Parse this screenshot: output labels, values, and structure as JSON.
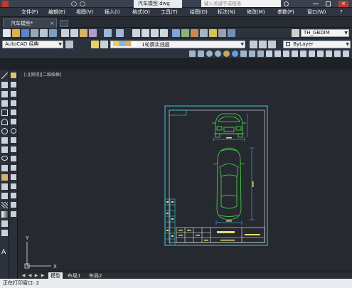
{
  "window": {
    "title_tab": "汽车模型.dwg",
    "search_placeholder": "键入关键字或短语"
  },
  "menu": [
    "文件(F)",
    "编辑(E)",
    "视图(V)",
    "插入(I)",
    "格式(O)",
    "工具(T)",
    "绘图(D)",
    "标注(N)",
    "修改(M)",
    "参数(P)",
    "窗口(W)"
  ],
  "doc_tab": {
    "label": "汽车模型*",
    "close": "×"
  },
  "toolbar": {
    "workspace": "AutoCAD 经典",
    "layer": "1轮廓实线层",
    "color": "ByLayer",
    "dimstyle": "TH_GBDIM"
  },
  "viewport_label": "[-][俯视][二维线框]",
  "layout_tabs": [
    "模型",
    "布局1",
    "布局2"
  ],
  "command_line": "正在打印窗口: 2",
  "icons": [
    "layer-icon",
    "sun-icon",
    "lock-icon",
    "match-properties-icon",
    "line-icon",
    "circle-icon",
    "move-icon",
    "rotate-icon",
    "copy-icon",
    "zoom-icon"
  ]
}
